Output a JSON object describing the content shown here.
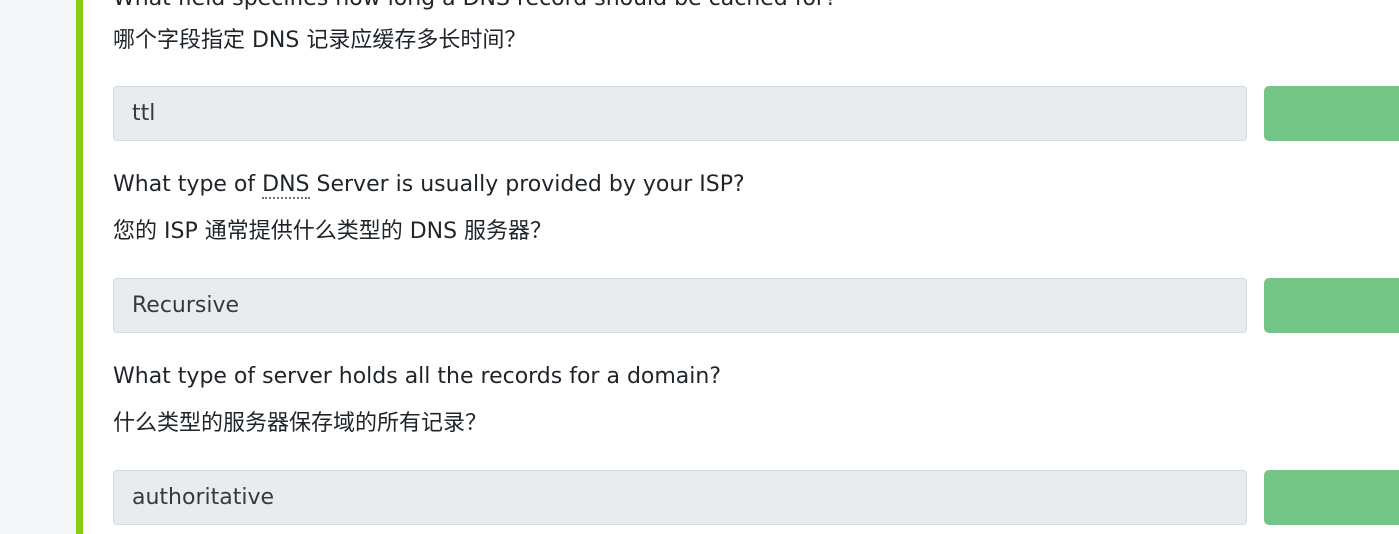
{
  "questions": [
    {
      "question_prefix": "What field specifies how long a DNS record should be cached for?",
      "translation": "哪个字段指定 DNS 记录应缓存多长时间？",
      "answer": "ttl"
    },
    {
      "question_prefix": "What type of ",
      "question_abbr": "DNS",
      "question_suffix": " Server is usually provided by your ISP?",
      "translation": "您的 ISP 通常提供什么类型的 DNS 服务器？",
      "answer": "Recursive"
    },
    {
      "question_prefix": "What type of server holds all the records for a domain?",
      "translation": "什么类型的服务器保存域的所有记录？",
      "answer": "authoritative"
    }
  ],
  "colors": {
    "accent": "#88cc14",
    "correct": "#73c686",
    "field_bg": "#e9ecef"
  }
}
